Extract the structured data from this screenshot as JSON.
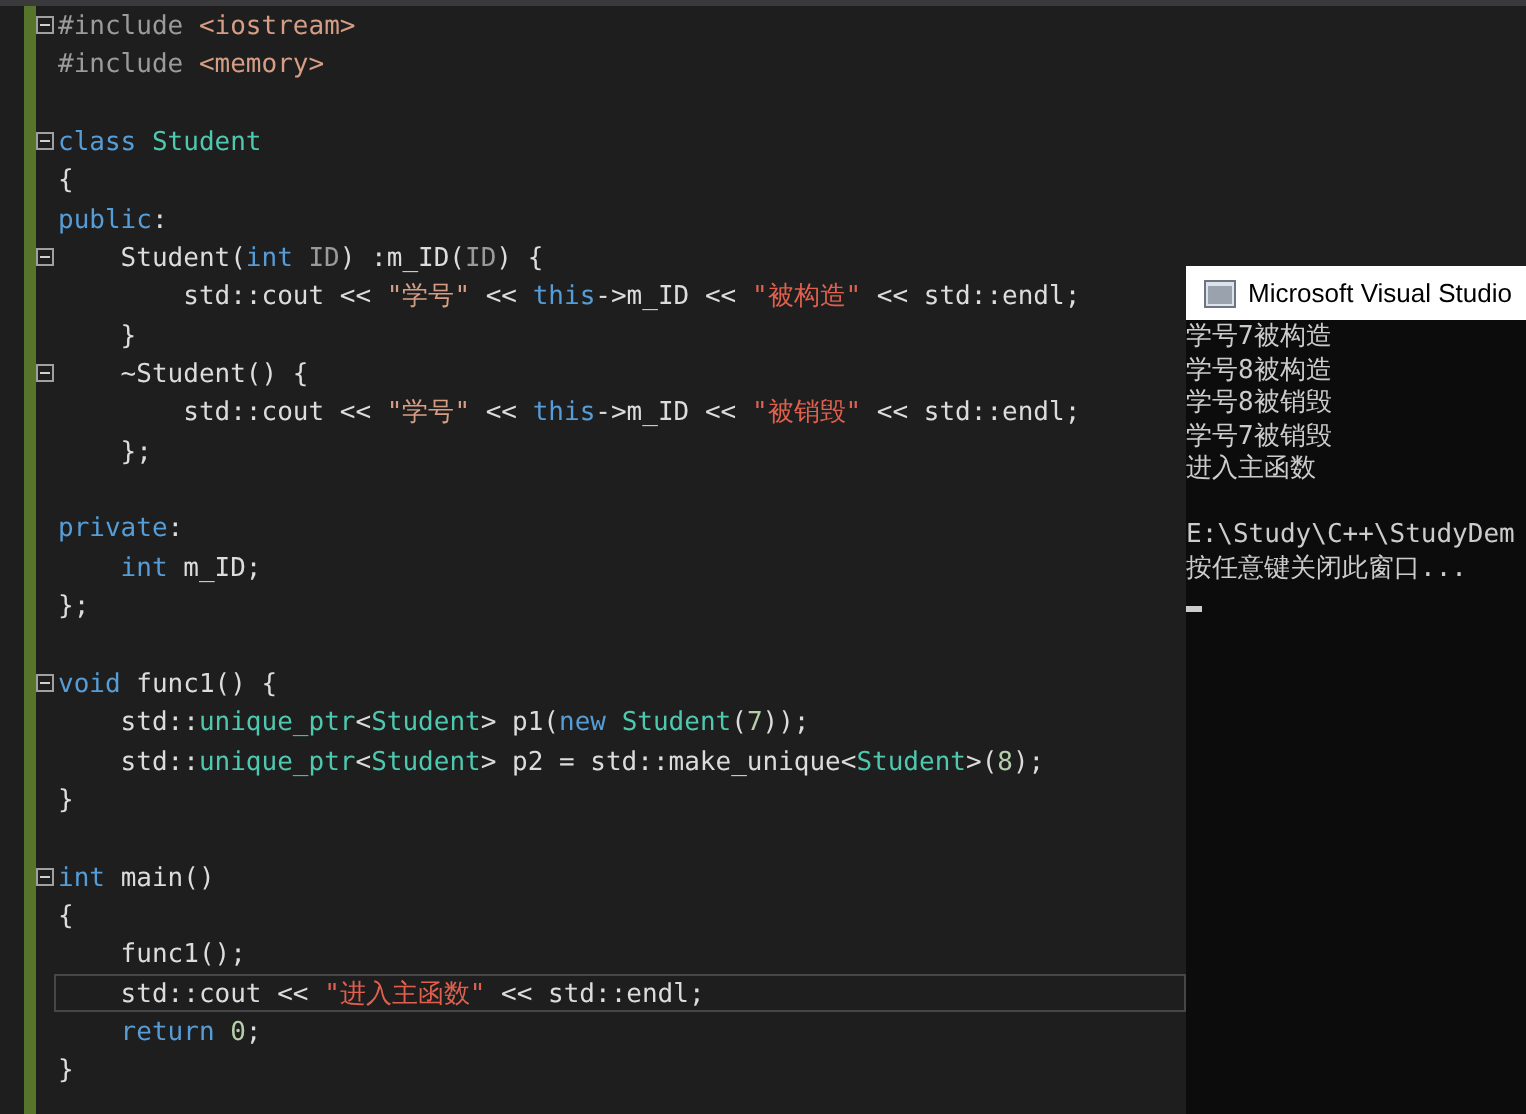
{
  "editor": {
    "lines": [
      {
        "fold": true,
        "current": false,
        "tokens": [
          {
            "kind": "preproc",
            "text": "#include "
          },
          {
            "kind": "string",
            "text": "<iostream>"
          }
        ]
      },
      {
        "fold": false,
        "current": false,
        "tokens": [
          {
            "kind": "preproc",
            "text": "#include "
          },
          {
            "kind": "string",
            "text": "<memory>"
          }
        ]
      },
      {
        "fold": false,
        "current": false
      },
      {
        "fold": true,
        "current": false,
        "tokens": [
          {
            "kind": "keyword",
            "text": "class "
          },
          {
            "kind": "type",
            "text": "Student"
          }
        ]
      },
      {
        "fold": false,
        "current": false,
        "tokens": [
          {
            "kind": "plain",
            "text": "{"
          }
        ]
      },
      {
        "fold": false,
        "current": false,
        "tokens": [
          {
            "kind": "keyword",
            "text": "public"
          },
          {
            "kind": "plain",
            "text": ":"
          }
        ]
      },
      {
        "fold": true,
        "current": false,
        "tokens": [
          {
            "kind": "plain",
            "text": "    Student("
          },
          {
            "kind": "keyword",
            "text": "int "
          },
          {
            "kind": "param",
            "text": "ID"
          },
          {
            "kind": "plain",
            "text": ") :m_ID("
          },
          {
            "kind": "param",
            "text": "ID"
          },
          {
            "kind": "plain",
            "text": ") {"
          }
        ]
      },
      {
        "fold": false,
        "current": false,
        "tokens": [
          {
            "kind": "plain",
            "text": "        std::cout << "
          },
          {
            "kind": "string",
            "text": "\"学号\""
          },
          {
            "kind": "plain",
            "text": " << "
          },
          {
            "kind": "keyword",
            "text": "this"
          },
          {
            "kind": "plain",
            "text": "->m_ID << "
          },
          {
            "kind": "string_alt",
            "text": "\"被构造\""
          },
          {
            "kind": "plain",
            "text": " << std::endl;"
          }
        ]
      },
      {
        "fold": false,
        "current": false,
        "tokens": [
          {
            "kind": "plain",
            "text": "    }"
          }
        ]
      },
      {
        "fold": true,
        "current": false,
        "tokens": [
          {
            "kind": "plain",
            "text": "    ~Student() {"
          }
        ]
      },
      {
        "fold": false,
        "current": false,
        "tokens": [
          {
            "kind": "plain",
            "text": "        std::cout << "
          },
          {
            "kind": "string",
            "text": "\"学号\""
          },
          {
            "kind": "plain",
            "text": " << "
          },
          {
            "kind": "keyword",
            "text": "this"
          },
          {
            "kind": "plain",
            "text": "->m_ID << "
          },
          {
            "kind": "string_alt",
            "text": "\"被销毁\""
          },
          {
            "kind": "plain",
            "text": " << std::endl;"
          }
        ]
      },
      {
        "fold": false,
        "current": false,
        "tokens": [
          {
            "kind": "plain",
            "text": "    };"
          }
        ]
      },
      {
        "fold": false,
        "current": false
      },
      {
        "fold": false,
        "current": false,
        "tokens": [
          {
            "kind": "keyword",
            "text": "private"
          },
          {
            "kind": "plain",
            "text": ":"
          }
        ]
      },
      {
        "fold": false,
        "current": false,
        "tokens": [
          {
            "kind": "keyword",
            "text": "    int "
          },
          {
            "kind": "plain",
            "text": "m_ID;"
          }
        ]
      },
      {
        "fold": false,
        "current": false,
        "tokens": [
          {
            "kind": "plain",
            "text": "};"
          }
        ]
      },
      {
        "fold": false,
        "current": false
      },
      {
        "fold": true,
        "current": false,
        "tokens": [
          {
            "kind": "keyword",
            "text": "void "
          },
          {
            "kind": "plain",
            "text": "func1() {"
          }
        ]
      },
      {
        "fold": false,
        "current": false,
        "tokens": [
          {
            "kind": "plain",
            "text": "    std::"
          },
          {
            "kind": "type",
            "text": "unique_ptr"
          },
          {
            "kind": "plain",
            "text": "<"
          },
          {
            "kind": "type",
            "text": "Student"
          },
          {
            "kind": "plain",
            "text": "> p1("
          },
          {
            "kind": "keyword",
            "text": "new "
          },
          {
            "kind": "type",
            "text": "Student"
          },
          {
            "kind": "plain",
            "text": "("
          },
          {
            "kind": "number",
            "text": "7"
          },
          {
            "kind": "plain",
            "text": "));"
          }
        ]
      },
      {
        "fold": false,
        "current": false,
        "tokens": [
          {
            "kind": "plain",
            "text": "    std::"
          },
          {
            "kind": "type",
            "text": "unique_ptr"
          },
          {
            "kind": "plain",
            "text": "<"
          },
          {
            "kind": "type",
            "text": "Student"
          },
          {
            "kind": "plain",
            "text": "> p2 = std::make_unique<"
          },
          {
            "kind": "type",
            "text": "Student"
          },
          {
            "kind": "plain",
            "text": ">("
          },
          {
            "kind": "number",
            "text": "8"
          },
          {
            "kind": "plain",
            "text": ");"
          }
        ]
      },
      {
        "fold": false,
        "current": false,
        "tokens": [
          {
            "kind": "plain",
            "text": "}"
          }
        ]
      },
      {
        "fold": false,
        "current": false
      },
      {
        "fold": true,
        "current": false,
        "tokens": [
          {
            "kind": "keyword",
            "text": "int "
          },
          {
            "kind": "plain",
            "text": "main()"
          }
        ]
      },
      {
        "fold": false,
        "current": false,
        "tokens": [
          {
            "kind": "plain",
            "text": "{"
          }
        ]
      },
      {
        "fold": false,
        "current": false,
        "tokens": [
          {
            "kind": "plain",
            "text": "    func1();"
          }
        ]
      },
      {
        "fold": false,
        "current": true,
        "tokens": [
          {
            "kind": "plain",
            "text": "    std::cout << "
          },
          {
            "kind": "string_alt",
            "text": "\"进入主函数\""
          },
          {
            "kind": "plain",
            "text": " << std::endl;"
          }
        ]
      },
      {
        "fold": false,
        "current": false,
        "tokens": [
          {
            "kind": "keyword",
            "text": "    return "
          },
          {
            "kind": "number",
            "text": "0"
          },
          {
            "kind": "plain",
            "text": ";"
          }
        ]
      },
      {
        "fold": false,
        "current": false,
        "tokens": [
          {
            "kind": "plain",
            "text": "}"
          }
        ]
      }
    ]
  },
  "console": {
    "title": "Microsoft Visual Studio",
    "output": [
      "学号7被构造",
      "学号8被构造",
      "学号8被销毁",
      "学号7被销毁",
      "进入主函数"
    ],
    "footer": [
      "E:\\Study\\C++\\StudyDem",
      "按任意键关闭此窗口..."
    ]
  }
}
